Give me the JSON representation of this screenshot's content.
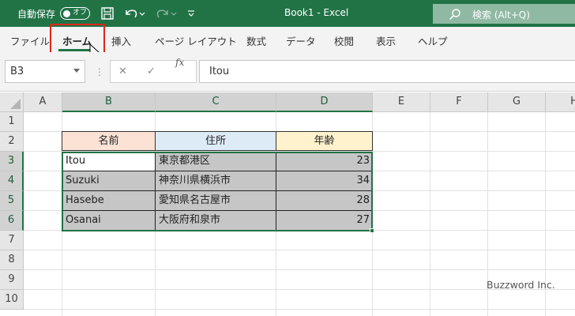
{
  "titlebar": {
    "autosave_label": "自動保存",
    "autosave_state": "オフ",
    "title": "Book1  -  Excel",
    "search_placeholder": "検索 (Alt+Q)",
    "bg_color": "#217346"
  },
  "tabs": [
    {
      "label": "ファイル"
    },
    {
      "label": "ホーム",
      "active": true
    },
    {
      "label": "挿入"
    },
    {
      "label": "ページ レイアウト"
    },
    {
      "label": "数式"
    },
    {
      "label": "データ"
    },
    {
      "label": "校閲"
    },
    {
      "label": "表示"
    },
    {
      "label": "ヘルプ"
    }
  ],
  "formula_bar": {
    "name_box": "B3",
    "fx_label": "fx",
    "value": "Itou"
  },
  "columns": [
    "A",
    "B",
    "C",
    "D",
    "E",
    "F",
    "G",
    "H"
  ],
  "rows": [
    "1",
    "2",
    "3",
    "4",
    "5",
    "6",
    "7",
    "8",
    "9",
    "10"
  ],
  "table": {
    "headers": [
      "名前",
      "住所",
      "年齢"
    ],
    "header_colors": [
      "#fbe2d5",
      "#ddebf7",
      "#fff2cc"
    ],
    "rows": [
      {
        "name": "Itou",
        "address": "東京都港区",
        "age": "23"
      },
      {
        "name": "Suzuki",
        "address": "神奈川県横浜市",
        "age": "34"
      },
      {
        "name": "Hasebe",
        "address": "愛知県名古屋市",
        "age": "28"
      },
      {
        "name": "Osanai",
        "address": "大阪府和泉市",
        "age": "27"
      }
    ]
  },
  "watermark": "Buzzword Inc."
}
